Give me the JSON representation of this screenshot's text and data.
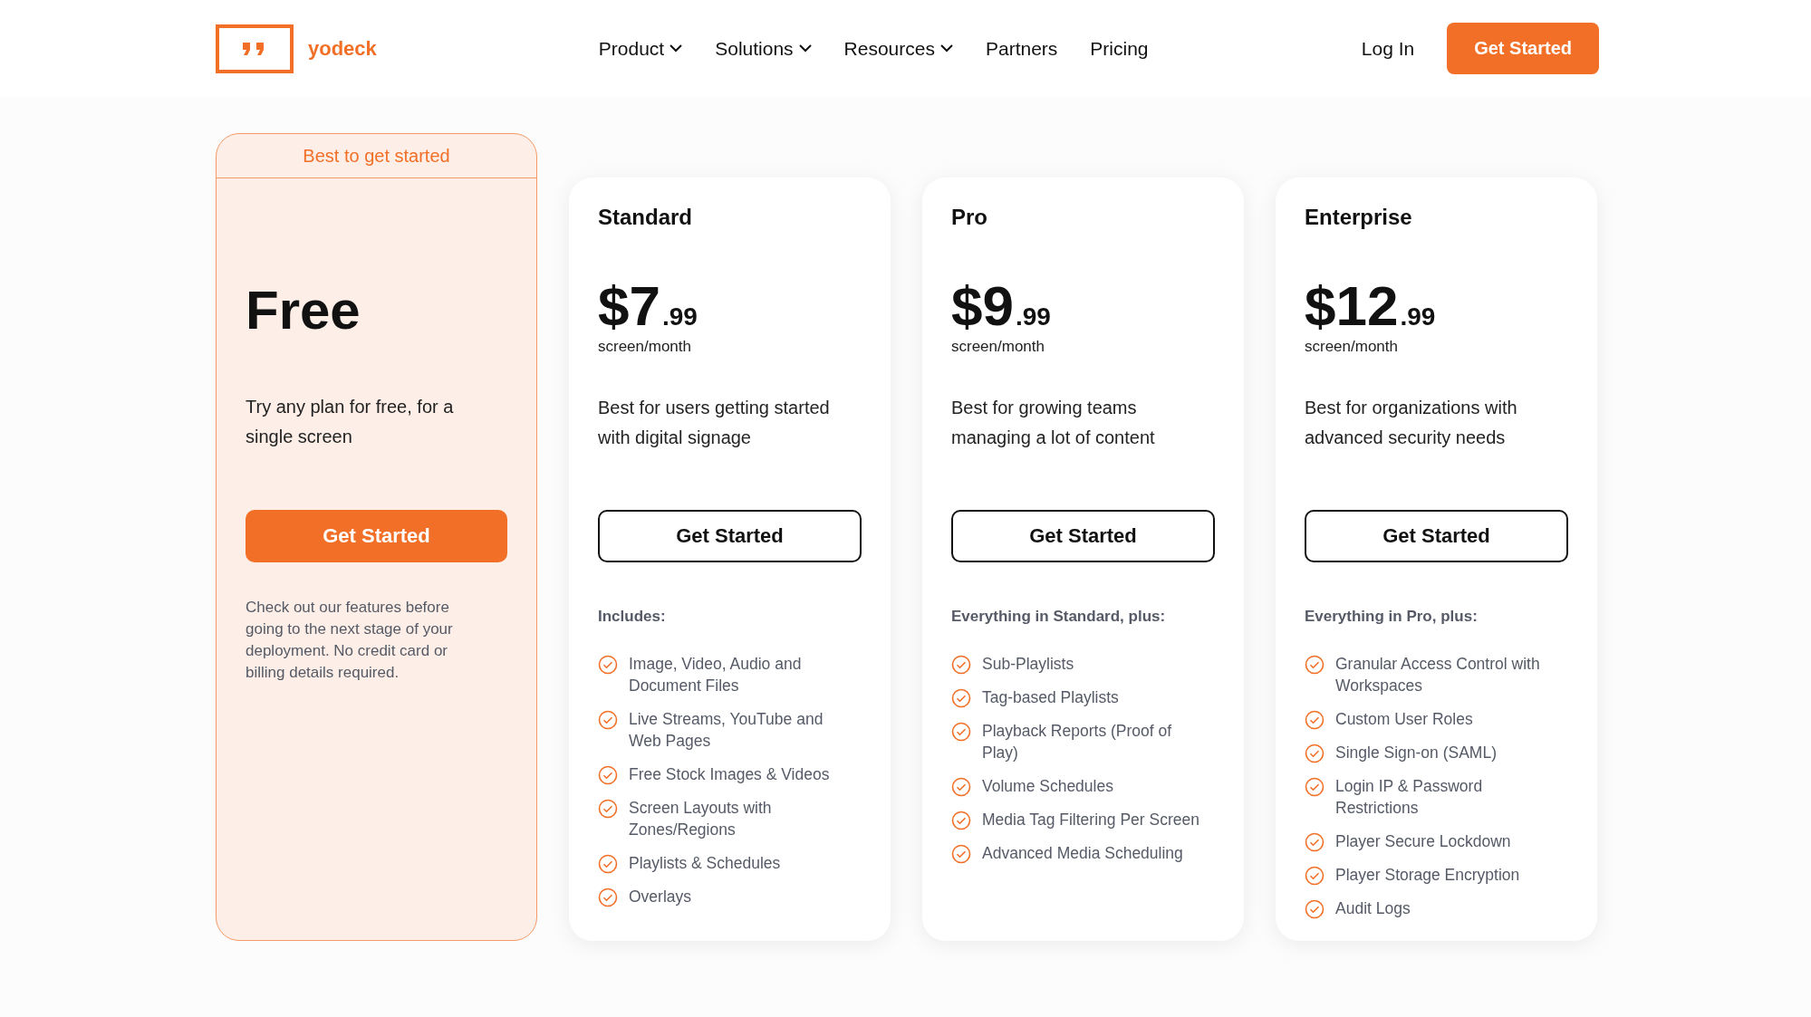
{
  "header": {
    "logo": {
      "text": "yodeck"
    },
    "nav": [
      {
        "label": "Product",
        "has_menu": true
      },
      {
        "label": "Solutions",
        "has_menu": true
      },
      {
        "label": "Resources",
        "has_menu": true
      },
      {
        "label": "Partners",
        "has_menu": false
      },
      {
        "label": "Pricing",
        "has_menu": false
      }
    ],
    "login": "Log In",
    "cta": "Get Started"
  },
  "plans": [
    {
      "kind": "free",
      "badge": "Best to get started",
      "title": "Free",
      "description": "Try any plan for free, for a single screen",
      "button": "Get Started",
      "note": "Check out our features before going to the next stage of your deployment. No credit card or billing details required."
    },
    {
      "kind": "paid",
      "name": "Standard",
      "price": "$7",
      "cents": ".99",
      "unit": "screen/month",
      "description": "Best for users getting started with digital signage",
      "button": "Get Started",
      "features_heading": "Includes:",
      "features": [
        "Image, Video, Audio and Document Files",
        "Live Streams, YouTube and Web Pages",
        "Free Stock Images & Videos",
        "Screen Layouts with Zones/Regions",
        "Playlists & Schedules",
        "Overlays"
      ]
    },
    {
      "kind": "paid",
      "name": "Pro",
      "price": "$9",
      "cents": ".99",
      "unit": "screen/month",
      "description": "Best for growing teams managing a lot of content",
      "button": "Get Started",
      "features_heading": "Everything in Standard, plus:",
      "features": [
        "Sub-Playlists",
        "Tag-based Playlists",
        "Playback Reports (Proof of Play)",
        "Volume Schedules",
        "Media Tag Filtering Per Screen",
        "Advanced Media Scheduling"
      ]
    },
    {
      "kind": "paid",
      "name": "Enterprise",
      "price": "$12",
      "cents": ".99",
      "unit": "screen/month",
      "description": "Best for organizations with advanced security needs",
      "button": "Get Started",
      "features_heading": "Everything in Pro, plus:",
      "features": [
        "Granular Access Control with Workspaces",
        "Custom User Roles",
        "Single Sign-on (SAML)",
        "Login IP & Password Restrictions",
        "Player Secure Lockdown",
        "Player Storage Encryption",
        "Audit Logs"
      ]
    }
  ]
}
